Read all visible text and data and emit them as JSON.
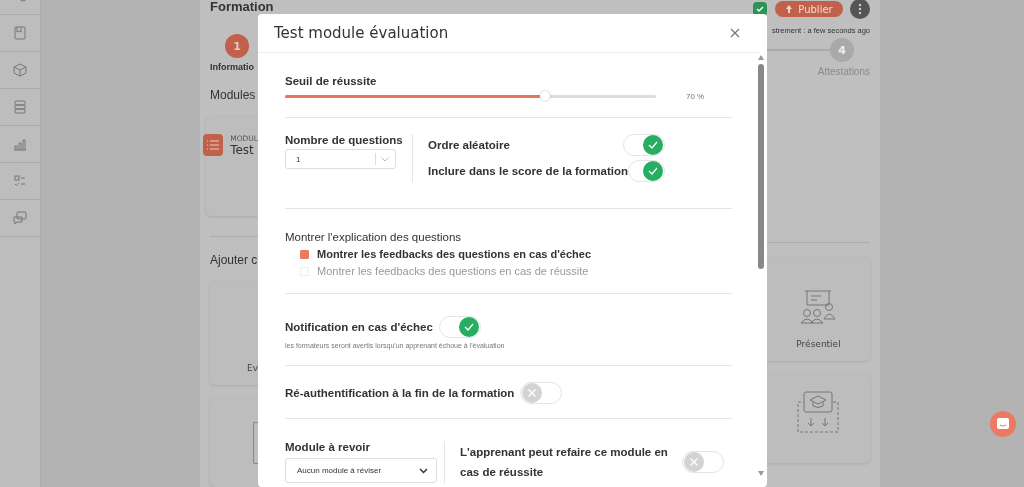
{
  "page": {
    "title": "Formation",
    "actions": [
      {
        "kind": "confirm"
      },
      {
        "kind": "publish",
        "label": "Publier"
      },
      {
        "kind": "more"
      }
    ],
    "save_status": "strement : a few seconds ago",
    "steps": [
      {
        "number": "1",
        "label": "Informatio",
        "active": true
      },
      {
        "number": "4",
        "label": "Attestations",
        "active": false
      }
    ],
    "modules_heading": "Modules",
    "module_card": {
      "caption": "MODUL",
      "title": "Test"
    },
    "add_heading": "Ajouter c",
    "left_cards": [
      {
        "label": "Ev"
      },
      {
        "kind": "frame"
      }
    ],
    "right_cards": [
      {
        "label": "Présentiel",
        "kind": "classroom"
      },
      {
        "kind": "download"
      }
    ]
  },
  "modal": {
    "title": "Test module évaluation",
    "threshold": {
      "label": "Seuil de réussite",
      "level": 0.7,
      "reading": "70 %"
    },
    "question_count": {
      "label": "Nombre de questions",
      "value": "1"
    },
    "options": [
      {
        "label": "Ordre aléatoire",
        "on": true
      },
      {
        "label": "Inclure dans le score de la formation",
        "on": true
      }
    ],
    "explanation": {
      "label": "Montrer l'explication des questions",
      "choices": [
        {
          "label": "Montrer les feedbacks des questions en cas d'échec",
          "checked": true
        },
        {
          "label": "Montrer les feedbacks des questions en cas de réussite",
          "checked": false
        }
      ]
    },
    "notification": {
      "label": "Notification en cas d'échec",
      "on": true,
      "hint": "les formateurs seront avertis lorsqu'un apprenant échoue à l'évaluation"
    },
    "reauth": {
      "label": "Ré-authentification à la fin de la formation",
      "on": false
    },
    "review_module": {
      "label": "Module à revoir",
      "value": "Aucun module à réviser"
    },
    "retake": {
      "label": "L'apprenant peut refaire ce module en cas de réussite",
      "on": false
    }
  }
}
